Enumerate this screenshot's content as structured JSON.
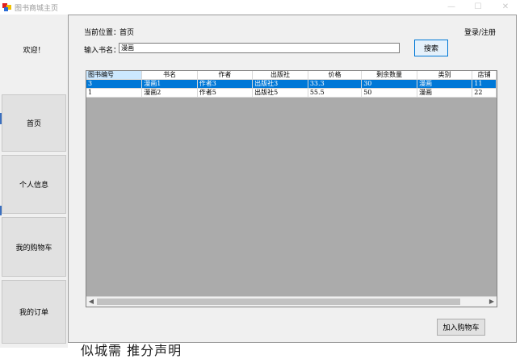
{
  "window": {
    "title": "图书商城主页",
    "controls": [
      "—",
      "☐",
      "✕"
    ]
  },
  "sidebar": {
    "welcome": "欢迎！",
    "items": [
      {
        "label": "首页"
      },
      {
        "label": "个人信息"
      },
      {
        "label": "我的购物车"
      },
      {
        "label": "我的订单"
      }
    ]
  },
  "header": {
    "location_label": "当前位置：",
    "location_value": "首页",
    "login_link": "登录/注册"
  },
  "search": {
    "label": "输入书名：",
    "value": "漫画",
    "button": "搜索"
  },
  "table": {
    "columns": [
      "图书编号",
      "书名",
      "作者",
      "出版社",
      "价格",
      "剩余数量",
      "类别",
      "店铺"
    ],
    "rows": [
      [
        "3",
        "漫画1",
        "作者3",
        "出版社3",
        "33.3",
        "30",
        "漫画",
        "11"
      ],
      [
        "1",
        "漫画2",
        "作者5",
        "出版社5",
        "55.5",
        "50",
        "漫画",
        "22"
      ]
    ],
    "selected_row": 0
  },
  "footer": {
    "add_to_cart": "加入购物车"
  },
  "underlay_text": "似城需 推分声明"
}
